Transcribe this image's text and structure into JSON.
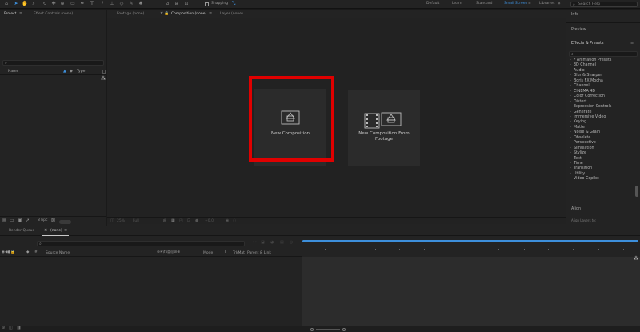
{
  "toolbar": {
    "snapping_label": "Snapping",
    "workspaces": [
      "Default",
      "Learn",
      "Standard",
      "Small Screen",
      "Libraries"
    ],
    "active_workspace": "Small Screen",
    "search_placeholder": "Search Help"
  },
  "project_panel": {
    "tabs": [
      "Project",
      "Effect Controls (none)"
    ],
    "columns": {
      "name": "Name",
      "type": "Type"
    },
    "footer_bpc": "8 bpc"
  },
  "viewer": {
    "tabs": [
      "Footage (none)",
      "Composition (none)",
      "Layer (none)"
    ],
    "new_composition_label": "New Composition",
    "new_comp_from_footage_label": "New Composition From Footage",
    "zoom_label": "25%",
    "resolution_label": "Full",
    "time_label": "+0.0"
  },
  "right_panel": {
    "info_label": "Info",
    "preview_label": "Preview",
    "effects_presets_label": "Effects & Presets",
    "effects_items": [
      "* Animation Presets",
      "3D Channel",
      "Audio",
      "Blur & Sharpen",
      "Boris FX Mocha",
      "Channel",
      "CINEMA 4D",
      "Color Correction",
      "Distort",
      "Expression Controls",
      "Generate",
      "Immersive Video",
      "Keying",
      "Matte",
      "Noise & Grain",
      "Obsolete",
      "Perspective",
      "Simulation",
      "Stylize",
      "Text",
      "Time",
      "Transition",
      "Utility",
      "Video Copilot"
    ],
    "align_label": "Align",
    "align_sub": "Align Layers to:"
  },
  "timeline": {
    "tabs": [
      "Render Queue",
      "(none)"
    ],
    "columns": {
      "source_name": "Source Name",
      "mode": "Mode",
      "trkmat": "TrkMat",
      "parent_link": "Parent & Link"
    }
  },
  "colors": {
    "accent_blue": "#3d8fdb",
    "highlight_red": "#e00000",
    "panel_bg": "#232323"
  }
}
